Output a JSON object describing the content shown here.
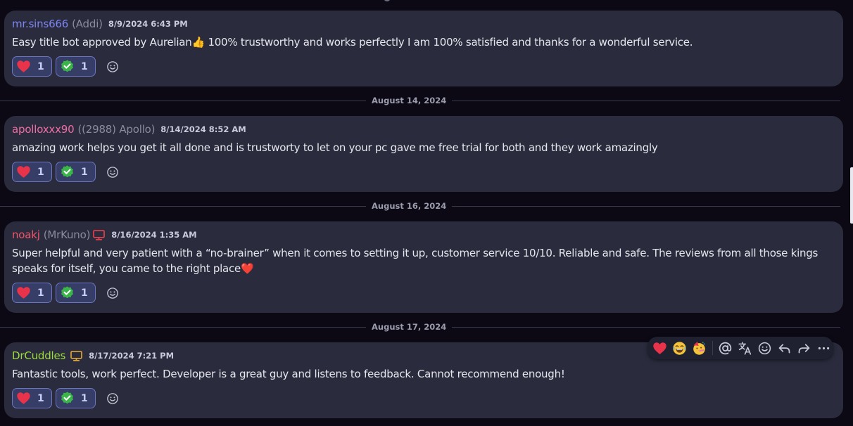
{
  "colors": {
    "background": "#0c0914",
    "message_bg": "#2a2c3e",
    "reaction_border": "#6b75c0",
    "reaction_bg": "#363d66"
  },
  "messages": [
    {
      "username": "mr.sins666",
      "username_color": "#7c85f0",
      "nickname": "(Addi)",
      "timestamp": "8/9/2024 6:43 PM",
      "content": "Easy title bot approved by Aurelian👍 100% trustworthy and works perfectly I am 100% satisfied and thanks for a wonderful service.",
      "reactions": [
        {
          "icon": "heart-icon",
          "count": "1"
        },
        {
          "icon": "check-badge-icon",
          "count": "1"
        }
      ]
    },
    {
      "username": "apolloxxx90",
      "username_color": "#f26da5",
      "nickname": "((2988) Apollo)",
      "timestamp": "8/14/2024 8:52 AM",
      "content": "amazing work helps you get it all done and is trustworty to let on your pc gave me free trial for both and they work amazingly",
      "reactions": [
        {
          "icon": "heart-icon",
          "count": "1"
        },
        {
          "icon": "check-badge-icon",
          "count": "1"
        }
      ]
    },
    {
      "username": "noakj",
      "username_color": "#f0556a",
      "nickname": "(MrKuno)",
      "device_icon": "desktop-icon",
      "device_color": "#e0424f",
      "timestamp": "8/16/2024 1:35 AM",
      "content": "Super helpful and very patient with a “no-brainer” when it comes to setting it up, customer service 10/10. Reliable and safe. The reviews from all those kings speaks for itself, you came to the right place❤️",
      "reactions": [
        {
          "icon": "heart-icon",
          "count": "1"
        },
        {
          "icon": "check-badge-icon",
          "count": "1"
        }
      ]
    },
    {
      "username": "DrCuddles",
      "username_color": "#9bdc3c",
      "nickname": "",
      "device_icon": "desktop-icon",
      "device_color": "#d9a53a",
      "timestamp": "8/17/2024 7:21 PM",
      "content": "Fantastic tools, work perfect. Developer is a great guy and listens to feedback. Cannot recommend enough!",
      "reactions": [
        {
          "icon": "heart-icon",
          "count": "1"
        },
        {
          "icon": "check-badge-icon",
          "count": "1"
        }
      ]
    }
  ],
  "dividers": [
    {
      "label": "August 14, 2024"
    },
    {
      "label": "August 16, 2024"
    },
    {
      "label": "August 17, 2024"
    }
  ],
  "action_bar": {
    "quick_reactions": [
      "heart-icon",
      "joy-emoji-icon",
      "party-emoji-icon"
    ],
    "actions": [
      "mention-icon",
      "translate-icon",
      "add-reaction-icon",
      "reply-icon",
      "forward-icon",
      "more-icon"
    ]
  }
}
